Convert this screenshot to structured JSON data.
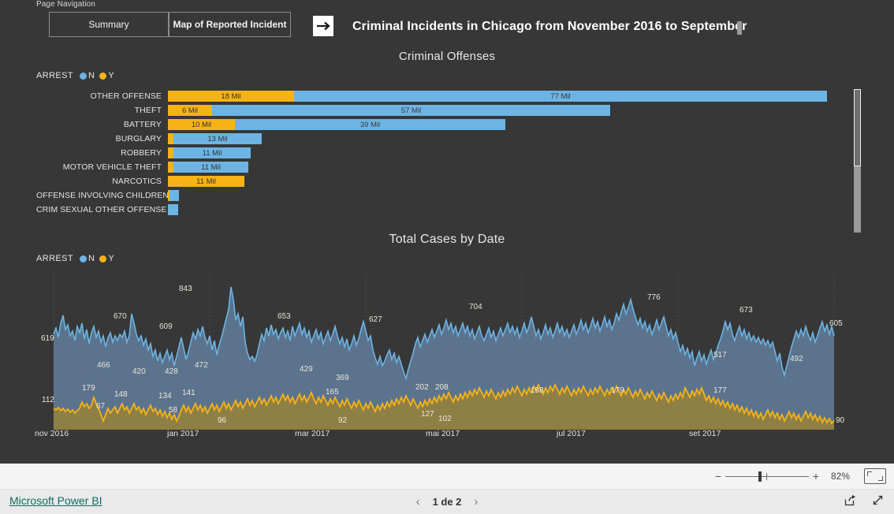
{
  "nav": {
    "label": "Page Navigation",
    "buttons": [
      {
        "label": "Summary",
        "name": "summary"
      },
      {
        "label": "Map of Reported Incident",
        "name": "map-of-reported-incident"
      }
    ],
    "arrow_icon": "arrow-right-icon"
  },
  "header": {
    "title": "Criminal Incidents in Chicago from November 2016 to September"
  },
  "offenses": {
    "title": "Criminal Offenses",
    "legend": {
      "title": "ARREST",
      "items": [
        {
          "label": "N",
          "color": "#6cb4e4"
        },
        {
          "label": "Y",
          "color": "#f5b316"
        }
      ]
    }
  },
  "cases": {
    "title": "Total Cases by Date",
    "legend": {
      "title": "ARREST",
      "items": [
        {
          "label": "N",
          "color": "#6cb4e4"
        },
        {
          "label": "Y",
          "color": "#f5b316"
        }
      ]
    }
  },
  "toolbar": {
    "zoom_minus": "−",
    "zoom_plus": "+",
    "zoom_percent": "82%",
    "fit_to_page_icon": "fit-to-page-icon"
  },
  "footer": {
    "brand": "Microsoft Power BI",
    "prev_icon": "chevron-left-icon",
    "next_icon": "chevron-right-icon",
    "page_indicator": "1 de 2",
    "share_icon": "share-icon",
    "fullscreen_icon": "fullscreen-icon"
  },
  "chart_data": [
    {
      "type": "bar",
      "title": "Criminal Offenses",
      "orientation": "horizontal",
      "stacked": true,
      "xlabel": "",
      "ylabel": "",
      "unit": "Mil",
      "legend": [
        "N",
        "Y"
      ],
      "legend_position": "top-left",
      "grid": false,
      "categories": [
        "OTHER OFFENSE",
        "THEFT",
        "BATTERY",
        "BURGLARY",
        "ROBBERY",
        "MOTOR VEHICLE THEFT",
        "NARCOTICS",
        "OFFENSE INVOLVING CHILDREN",
        "CRIM SEXUAL OTHER OFFENSE"
      ],
      "series": [
        {
          "name": "Y",
          "color": "#f5b316",
          "values": [
            18,
            6,
            10,
            0.6,
            0.8,
            0.8,
            11,
            0.4,
            0.1
          ],
          "labels": [
            "18 Mil",
            "6 Mil",
            "10 Mil",
            "",
            "",
            "",
            "11 Mil",
            "",
            ""
          ]
        },
        {
          "name": "N",
          "color": "#6cb4e4",
          "values": [
            77,
            57,
            39,
            13,
            11,
            11,
            0,
            1.2,
            1.3
          ],
          "labels": [
            "77 Mil",
            "57 Mil",
            "39 Mil",
            "13 Mil",
            "11 Mil",
            "11 Mil",
            "",
            "",
            ""
          ]
        }
      ]
    },
    {
      "type": "area",
      "title": "Total Cases by Date",
      "xlabel": "",
      "ylabel": "",
      "grid": true,
      "legend": [
        "N",
        "Y"
      ],
      "legend_position": "top-left",
      "x_ticks": [
        "nov 2016",
        "jan 2017",
        "mar 2017",
        "mai 2017",
        "jul 2017",
        "set 2017"
      ],
      "x_range": [
        "November 2016",
        "September 2017"
      ],
      "series": [
        {
          "name": "N",
          "color": "#6cb4e4",
          "annotations": [
            {
              "value": 619,
              "label": "619"
            },
            {
              "value": 670,
              "label": "670"
            },
            {
              "value": 843,
              "label": "843"
            },
            {
              "value": 609,
              "label": "609"
            },
            {
              "value": 466,
              "label": "466"
            },
            {
              "value": 420,
              "label": "420"
            },
            {
              "value": 428,
              "label": "428"
            },
            {
              "value": 472,
              "label": "472"
            },
            {
              "value": 653,
              "label": "653"
            },
            {
              "value": 429,
              "label": "429"
            },
            {
              "value": 369,
              "label": "369"
            },
            {
              "value": 627,
              "label": "627"
            },
            {
              "value": 704,
              "label": "704"
            },
            {
              "value": 776,
              "label": "776"
            },
            {
              "value": 517,
              "label": "517"
            },
            {
              "value": 673,
              "label": "673"
            },
            {
              "value": 492,
              "label": "492"
            },
            {
              "value": 605,
              "label": "605"
            }
          ]
        },
        {
          "name": "Y",
          "color": "#f5b316",
          "annotations": [
            {
              "value": 112,
              "label": "112"
            },
            {
              "value": 179,
              "label": "179"
            },
            {
              "value": 67,
              "label": "67"
            },
            {
              "value": 148,
              "label": "148"
            },
            {
              "value": 134,
              "label": "134"
            },
            {
              "value": 141,
              "label": "141"
            },
            {
              "value": 58,
              "label": "58"
            },
            {
              "value": 96,
              "label": "96"
            },
            {
              "value": 165,
              "label": "165"
            },
            {
              "value": 92,
              "label": "92"
            },
            {
              "value": 202,
              "label": "202"
            },
            {
              "value": 208,
              "label": "208"
            },
            {
              "value": 127,
              "label": "127"
            },
            {
              "value": 102,
              "label": "102"
            },
            {
              "value": 198,
              "label": "198"
            },
            {
              "value": 179,
              "label": "179"
            },
            {
              "value": 177,
              "label": "177"
            },
            {
              "value": 90,
              "label": "90"
            }
          ]
        }
      ]
    }
  ]
}
